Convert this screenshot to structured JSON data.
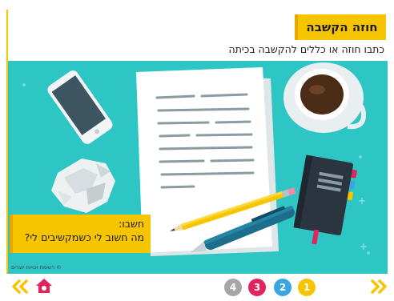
{
  "header": {
    "title": "חוזה הקשבה",
    "instruction": "כתבו חוזה או כללים להקשבה בכיתה"
  },
  "callout": {
    "label": "חשבו:",
    "question": "מה חשוב לי כשמקשיבים לי?"
  },
  "credit": "© רשימת זכויות יוצרים",
  "pagination": {
    "pages": [
      "4",
      "3",
      "2",
      "1"
    ],
    "current": "1"
  },
  "colors": {
    "accent_yellow": "#f7c500",
    "scene_teal": "#2ec6c4",
    "page4": "#a6a6a6",
    "page3": "#e0245e",
    "page2": "#3aa5e0",
    "page1": "#f7c500",
    "nav_arrows": "#f7c500",
    "home": "#e0245e"
  },
  "icons": {
    "prev": "double-chevron-left-icon",
    "next": "double-chevron-right-icon",
    "home": "home-icon"
  }
}
